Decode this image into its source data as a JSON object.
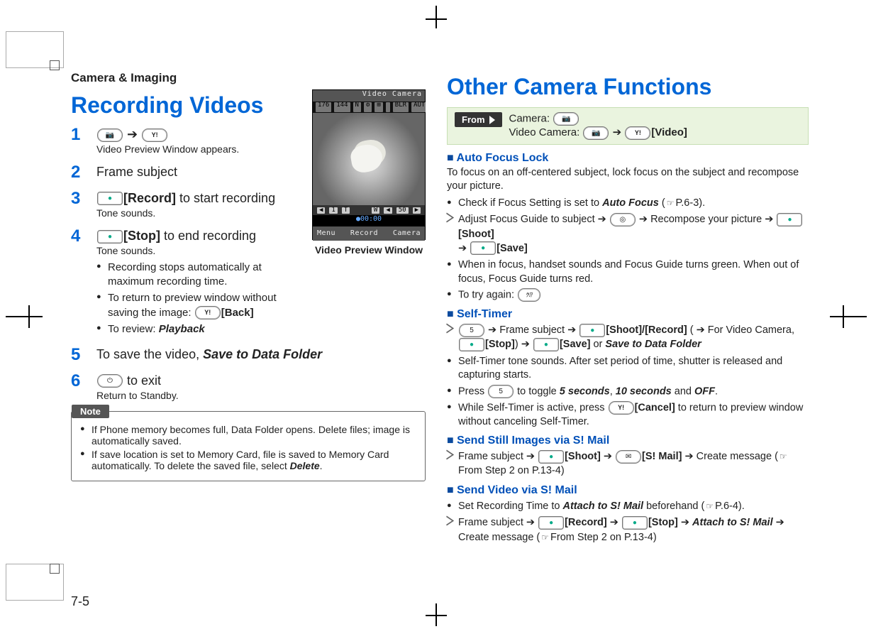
{
  "header": {
    "section": "Camera & Imaging"
  },
  "left": {
    "title": "Recording Videos",
    "figure": {
      "topbar": "Video Camera",
      "icons": [
        "176",
        "144",
        "N",
        "⚙",
        "⊞"
      ],
      "right_icons": [
        "BLR",
        "AUTO"
      ],
      "midbar_left": [
        "◀",
        "1",
        "T"
      ],
      "midbar_right": [
        "W",
        "◀",
        "50",
        "▶"
      ],
      "time": "●00:00",
      "softkeys": [
        "Menu",
        "Record",
        "Camera"
      ],
      "caption": "Video Preview Window"
    },
    "steps": [
      {
        "num": "1",
        "head_pre_keys": [
          "cam",
          "arrow",
          "y"
        ],
        "sub": "Video Preview Window appears."
      },
      {
        "num": "2",
        "head": "Frame subject"
      },
      {
        "num": "3",
        "head_key": "center",
        "head_bold": "[Record]",
        "head_after": " to start recording",
        "sub": "Tone sounds."
      },
      {
        "num": "4",
        "head_key": "center",
        "head_bold": "[Stop]",
        "head_after": " to end recording",
        "sub": "Tone sounds.",
        "bullets": [
          {
            "text": "Recording stops automatically at maximum recording time."
          },
          {
            "text_pre": "To return to preview window without saving the image: ",
            "key": "y",
            "bold": "[Back]"
          },
          {
            "text_pre": "To review: ",
            "italic": "Playback"
          }
        ]
      },
      {
        "num": "5",
        "head_pre": "To save the video, ",
        "head_italic": "Save to Data Folder"
      },
      {
        "num": "6",
        "head_key": "end",
        "head_after": " to exit",
        "sub": "Return to Standby."
      }
    ],
    "note": {
      "tag": "Note",
      "bullets": [
        "If Phone memory becomes full, Data Folder opens. Delete files; image is automatically saved.",
        "If save location is set to Memory Card, file is saved to Memory Card automatically. To delete the saved file, select "
      ],
      "delete_word": "Delete",
      "period": "."
    }
  },
  "right": {
    "title": "Other Camera Functions",
    "from": {
      "tag": "From",
      "camera_label": "Camera: ",
      "video_label": "Video Camera: ",
      "video_suffix": "[Video]"
    },
    "s1": {
      "head": "Auto Focus Lock",
      "intro": "To focus on an off-centered subject, lock focus on the subject and recompose your picture.",
      "b1_pre": "Check if Focus Setting is set to ",
      "b1_italic": "Auto Focus",
      "b1_ref": "P.6-3",
      "chev1_a": "Adjust Focus Guide to subject",
      "chev1_b": "Recompose your picture",
      "chev1_shoot": "[Shoot]",
      "chev1_save": "[Save]",
      "b2": "When in focus, handset sounds and Focus Guide turns green. When out of focus, Focus Guide turns red.",
      "b3": "To try again: "
    },
    "s2": {
      "head": "Self-Timer",
      "chev_a": "Frame subject",
      "shoot_rec": "[Shoot]/[Record]",
      "paren": " ( ➔ For Video Camera, ",
      "stop": "[Stop]",
      "save": "[Save]",
      "or": " or ",
      "std": "Save to Data Folder",
      "b1": "Self-Timer tone sounds. After set period of time, shutter is released and capturing starts.",
      "b2_pre": "Press ",
      "b2_mid": " to toggle ",
      "b2_5s": "5 seconds",
      "b2_comma": ", ",
      "b2_10s": "10 seconds",
      "b2_and": " and ",
      "b2_off": "OFF",
      "b2_period": ".",
      "b3_pre": "While Self-Timer is active, press ",
      "b3_cancel": "[Cancel]",
      "b3_post": " to return to preview window without canceling Self-Timer."
    },
    "s3": {
      "head": "Send Still Images via S! Mail",
      "frame": "Frame subject",
      "shoot": "[Shoot]",
      "smail": "[S! Mail]",
      "create": "Create message",
      "ref": "From Step 2 on P.13-4"
    },
    "s4": {
      "head": "Send Video via S! Mail",
      "b1_pre": "Set Recording Time to ",
      "b1_italic": "Attach to S! Mail",
      "b1_post": " beforehand (",
      "b1_ref": "P.6-4",
      "b1_close": ").",
      "frame": "Frame subject",
      "record": "[Record]",
      "stop": "[Stop]",
      "attach": "Attach to S! Mail",
      "create": "Create message",
      "ref": "From Step 2 on P.13-4"
    }
  },
  "footer": {
    "page": "7-5"
  }
}
